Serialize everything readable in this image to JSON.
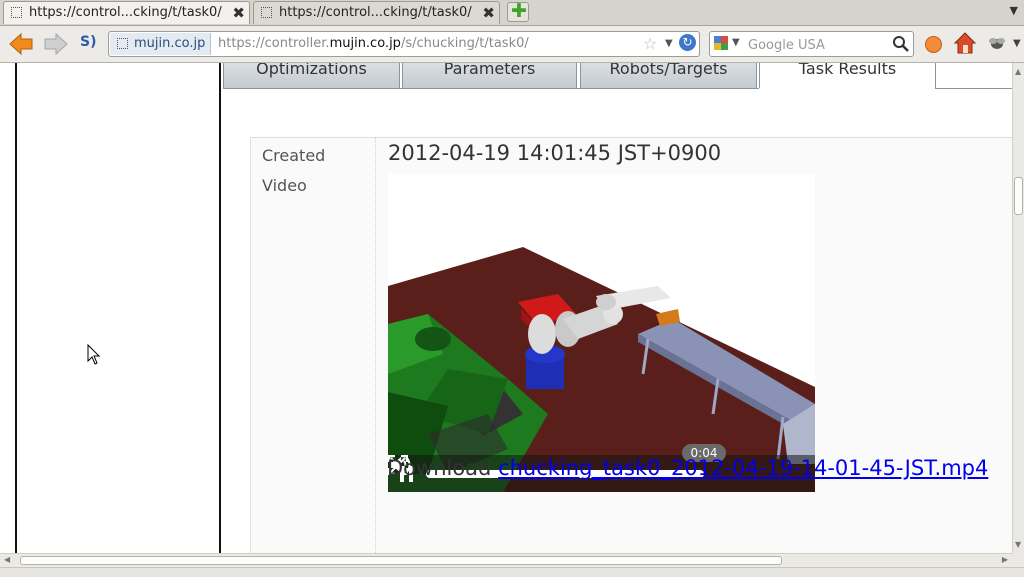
{
  "browser": {
    "tabs": [
      {
        "title": "https://control...cking/t/task0/",
        "active": true
      },
      {
        "title": "https://control...cking/t/task0/",
        "active": false
      }
    ],
    "identity_label": "mujin.co.jp",
    "url_prefix": "https://controller.",
    "url_domain": "mujin.co.jp",
    "url_path": "/s/chucking/t/task0/",
    "search_placeholder": "Google USA",
    "icons": [
      "back-icon",
      "forward-icon",
      "s-icon",
      "star-icon",
      "reload-icon",
      "google-icon",
      "magnifier-icon",
      "persona-icon",
      "home-icon",
      "bug-icon",
      "new-tab-icon",
      "close-icon"
    ]
  },
  "page": {
    "tabs": [
      {
        "label": "Optimizations",
        "active": false
      },
      {
        "label": "Parameters",
        "active": false
      },
      {
        "label": "Robots/Targets",
        "active": false
      },
      {
        "label": "Task Results",
        "active": true
      }
    ],
    "rows": {
      "created_label": "Created",
      "created_value": "2012-04-19 14:01:45 JST+0900",
      "video_label": "Video"
    },
    "video": {
      "current_time": "0:04",
      "progress": 0.96,
      "colors": {
        "floor": "#5a1f1a",
        "machine": "#1e7a1e",
        "robot_base": "#1e2fb5",
        "conveyor": "#8a93b5"
      }
    },
    "download": {
      "label": "Download",
      "filename": "chucking_task0_2012-04-19-14-01-45-JST.mp4"
    }
  }
}
